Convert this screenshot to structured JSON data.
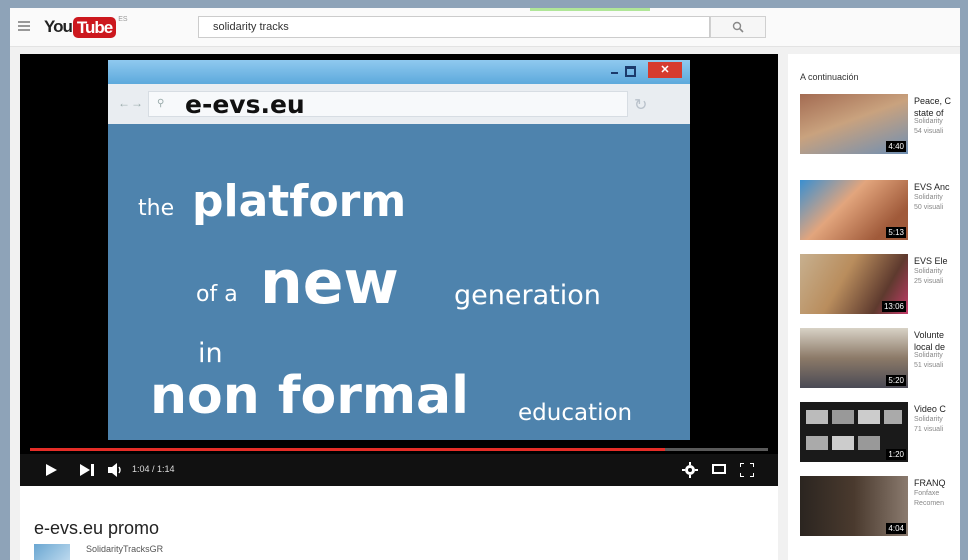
{
  "header": {
    "logo_you": "You",
    "logo_tube": "Tube",
    "logo_region": "ES",
    "search_query": "solidarity tracks"
  },
  "player": {
    "browser_url": "e-evs.eu",
    "video_text": {
      "line1_small": "the",
      "line1_big": "platform",
      "line2_small": "of a",
      "line2_big": "new",
      "line2_tail": "generation",
      "line3": "in",
      "line4_big": "non formal",
      "line4_tail": "education"
    },
    "time_display": "1:04 / 1:14",
    "progress_fraction": 0.86
  },
  "video": {
    "title": "e-evs.eu promo",
    "channel": "SolidarityTracksGR"
  },
  "sidebar": {
    "up_next_label": "A continuación",
    "more": "",
    "items": [
      {
        "title": "Peace, C",
        "title2": "state of",
        "channel": "Solidarity",
        "views": "54 visuali",
        "duration": "4:40"
      },
      {
        "title": "EVS Anc",
        "channel": "Solidarity",
        "views": "50 visuali",
        "duration": "5:13"
      },
      {
        "title": "EVS Ele",
        "channel": "Solidarity",
        "views": "25 visuali",
        "duration": "13:06"
      },
      {
        "title": "Volunte",
        "title2": "local de",
        "channel": "Solidarity",
        "views": "51 visuali",
        "duration": "5:20"
      },
      {
        "title": "Video C",
        "channel": "Solidarity",
        "views": "71 visuali",
        "duration": "1:20"
      },
      {
        "title": "FRANQ",
        "channel": "Fonfaxe",
        "views": "Recomen",
        "duration": "4:04"
      }
    ]
  }
}
